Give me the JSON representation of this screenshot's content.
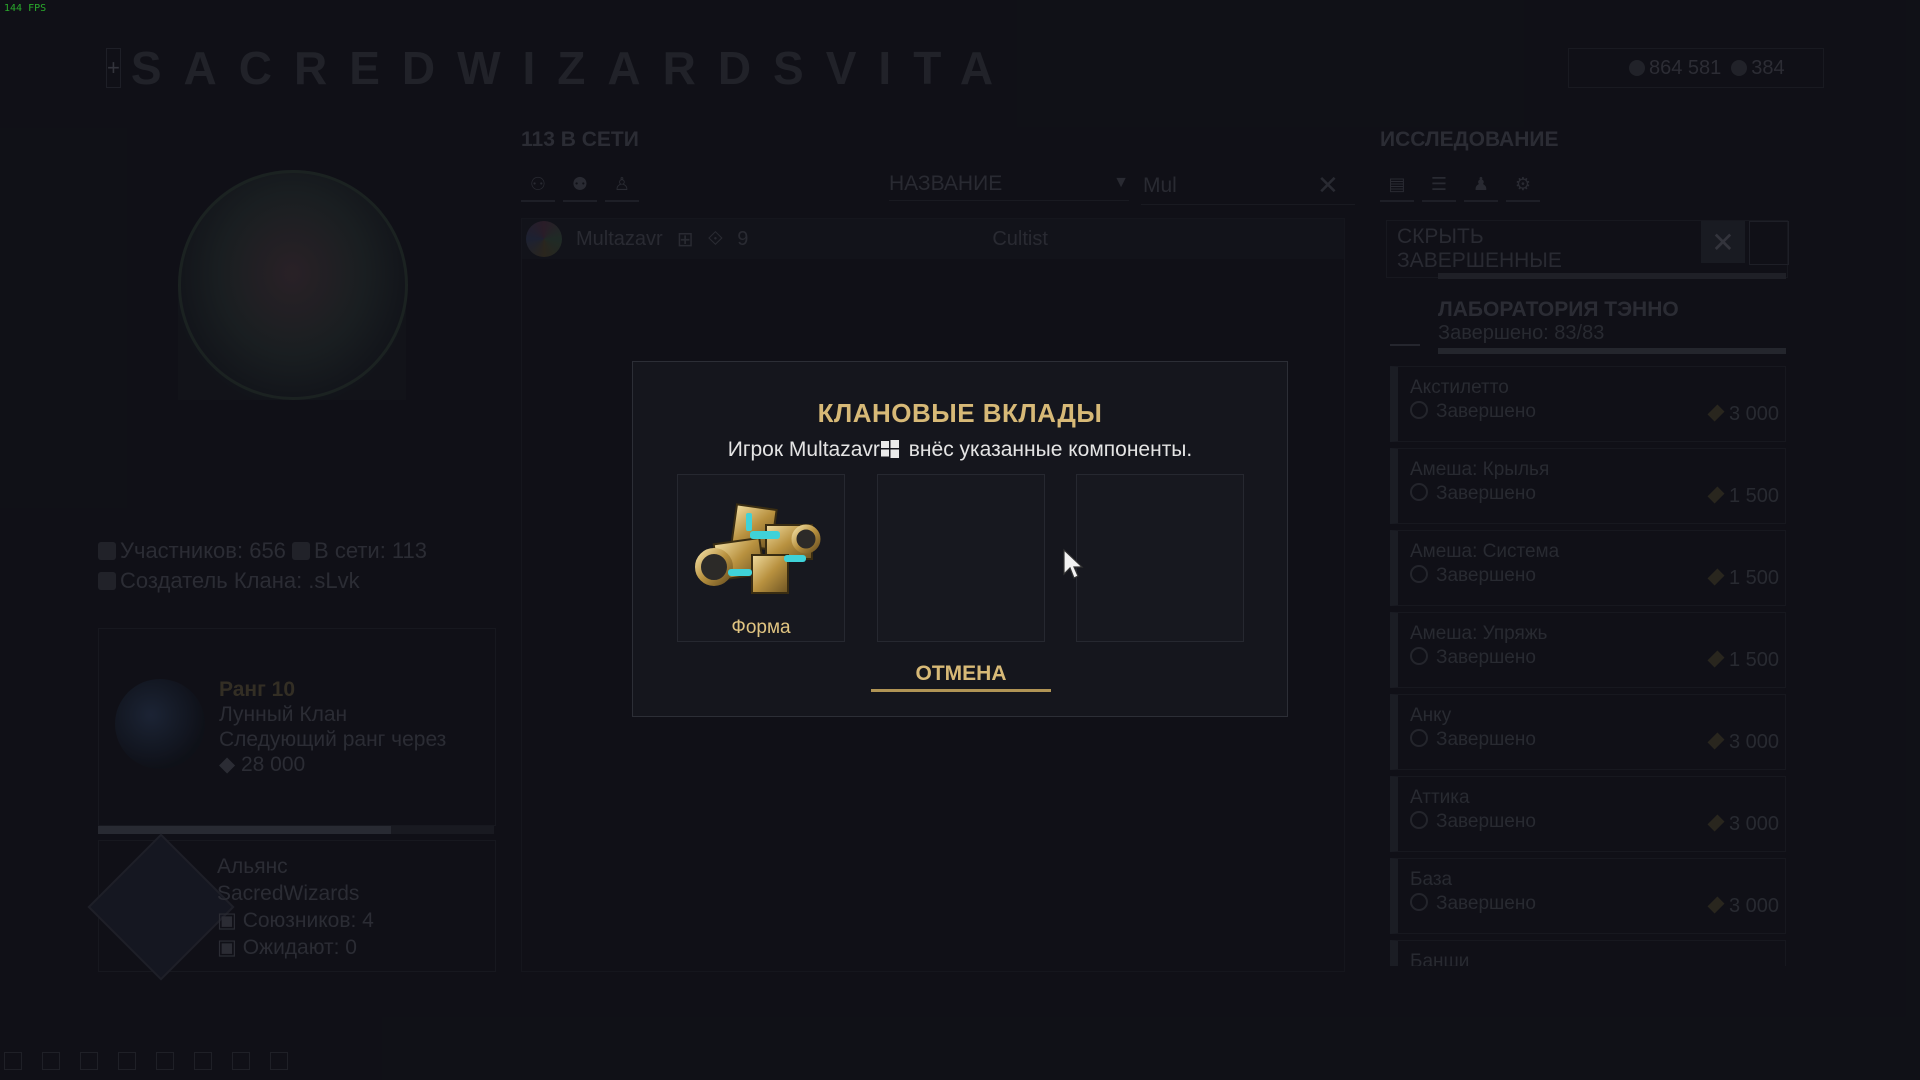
{
  "fps": "144 FPS",
  "header": {
    "clan_name": "SACREDWIZARDSVITA",
    "plus_label": "+",
    "credits": "864 581",
    "platinum": "384"
  },
  "profile": {
    "members_label": "Участников: 656",
    "online_label": "В сети: 113",
    "creator_label": "Создатель Клана: .sLvk"
  },
  "rank": {
    "rank": "Ранг 10",
    "clan_type": "Лунный Клан",
    "next_rank": "Следующий ранг через",
    "cost": "28 000",
    "progress": 0.74
  },
  "alliance": {
    "label": "Альянс",
    "name": "SacredWizards",
    "allies": "Союзников: 4",
    "pending": "Ожидают: 0"
  },
  "members_panel": {
    "title": "113 В СЕТИ",
    "sort_label": "НАЗВАНИЕ",
    "filter_value": "Mul",
    "rows": [
      {
        "name": "Multazavr",
        "mastery": "9",
        "role": "Cultist"
      }
    ]
  },
  "research_panel": {
    "title": "ИССЛЕДОВАНИЕ",
    "hide_completed": "СКРЫТЬ ЗАВЕРШЕННЫЕ",
    "lab_name": "ЛАБОРАТОРИЯ ТЭННО",
    "lab_progress": "Завершено: 83/83",
    "items": [
      {
        "name": "Акстилетто",
        "status": "Завершено",
        "cost": "3 000"
      },
      {
        "name": "Амеша: Крылья",
        "status": "Завершено",
        "cost": "1 500"
      },
      {
        "name": "Амеша: Система",
        "status": "Завершено",
        "cost": "1 500"
      },
      {
        "name": "Амеша: Упряжь",
        "status": "Завершено",
        "cost": "1 500"
      },
      {
        "name": "Анку",
        "status": "Завершено",
        "cost": "3 000"
      },
      {
        "name": "Аттика",
        "status": "Завершено",
        "cost": "3 000"
      },
      {
        "name": "База",
        "status": "Завершено",
        "cost": "3 000"
      },
      {
        "name": "Банши",
        "status": "",
        "cost": ""
      }
    ]
  },
  "modal": {
    "title": "КЛАНОВЫЕ ВКЛАДЫ",
    "message_prefix": "Игрок Multazavr",
    "message_suffix": " внёс указанные компоненты.",
    "slots": [
      {
        "label": "Форма",
        "icon": "forma-icon"
      },
      {
        "label": ""
      },
      {
        "label": ""
      }
    ],
    "cancel_label": "ОТМЕНА"
  }
}
